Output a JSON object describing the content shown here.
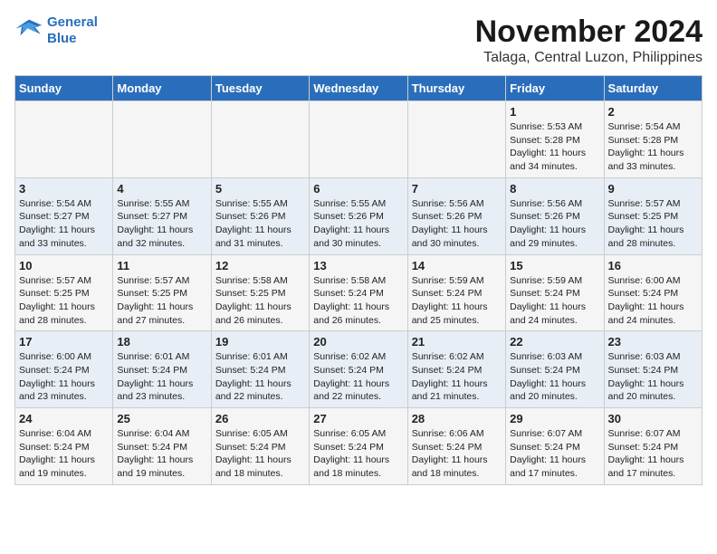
{
  "header": {
    "logo_line1": "General",
    "logo_line2": "Blue",
    "month": "November 2024",
    "location": "Talaga, Central Luzon, Philippines"
  },
  "weekdays": [
    "Sunday",
    "Monday",
    "Tuesday",
    "Wednesday",
    "Thursday",
    "Friday",
    "Saturday"
  ],
  "weeks": [
    [
      {
        "day": "",
        "info": ""
      },
      {
        "day": "",
        "info": ""
      },
      {
        "day": "",
        "info": ""
      },
      {
        "day": "",
        "info": ""
      },
      {
        "day": "",
        "info": ""
      },
      {
        "day": "1",
        "info": "Sunrise: 5:53 AM\nSunset: 5:28 PM\nDaylight: 11 hours\nand 34 minutes."
      },
      {
        "day": "2",
        "info": "Sunrise: 5:54 AM\nSunset: 5:28 PM\nDaylight: 11 hours\nand 33 minutes."
      }
    ],
    [
      {
        "day": "3",
        "info": "Sunrise: 5:54 AM\nSunset: 5:27 PM\nDaylight: 11 hours\nand 33 minutes."
      },
      {
        "day": "4",
        "info": "Sunrise: 5:55 AM\nSunset: 5:27 PM\nDaylight: 11 hours\nand 32 minutes."
      },
      {
        "day": "5",
        "info": "Sunrise: 5:55 AM\nSunset: 5:26 PM\nDaylight: 11 hours\nand 31 minutes."
      },
      {
        "day": "6",
        "info": "Sunrise: 5:55 AM\nSunset: 5:26 PM\nDaylight: 11 hours\nand 30 minutes."
      },
      {
        "day": "7",
        "info": "Sunrise: 5:56 AM\nSunset: 5:26 PM\nDaylight: 11 hours\nand 30 minutes."
      },
      {
        "day": "8",
        "info": "Sunrise: 5:56 AM\nSunset: 5:26 PM\nDaylight: 11 hours\nand 29 minutes."
      },
      {
        "day": "9",
        "info": "Sunrise: 5:57 AM\nSunset: 5:25 PM\nDaylight: 11 hours\nand 28 minutes."
      }
    ],
    [
      {
        "day": "10",
        "info": "Sunrise: 5:57 AM\nSunset: 5:25 PM\nDaylight: 11 hours\nand 28 minutes."
      },
      {
        "day": "11",
        "info": "Sunrise: 5:57 AM\nSunset: 5:25 PM\nDaylight: 11 hours\nand 27 minutes."
      },
      {
        "day": "12",
        "info": "Sunrise: 5:58 AM\nSunset: 5:25 PM\nDaylight: 11 hours\nand 26 minutes."
      },
      {
        "day": "13",
        "info": "Sunrise: 5:58 AM\nSunset: 5:24 PM\nDaylight: 11 hours\nand 26 minutes."
      },
      {
        "day": "14",
        "info": "Sunrise: 5:59 AM\nSunset: 5:24 PM\nDaylight: 11 hours\nand 25 minutes."
      },
      {
        "day": "15",
        "info": "Sunrise: 5:59 AM\nSunset: 5:24 PM\nDaylight: 11 hours\nand 24 minutes."
      },
      {
        "day": "16",
        "info": "Sunrise: 6:00 AM\nSunset: 5:24 PM\nDaylight: 11 hours\nand 24 minutes."
      }
    ],
    [
      {
        "day": "17",
        "info": "Sunrise: 6:00 AM\nSunset: 5:24 PM\nDaylight: 11 hours\nand 23 minutes."
      },
      {
        "day": "18",
        "info": "Sunrise: 6:01 AM\nSunset: 5:24 PM\nDaylight: 11 hours\nand 23 minutes."
      },
      {
        "day": "19",
        "info": "Sunrise: 6:01 AM\nSunset: 5:24 PM\nDaylight: 11 hours\nand 22 minutes."
      },
      {
        "day": "20",
        "info": "Sunrise: 6:02 AM\nSunset: 5:24 PM\nDaylight: 11 hours\nand 22 minutes."
      },
      {
        "day": "21",
        "info": "Sunrise: 6:02 AM\nSunset: 5:24 PM\nDaylight: 11 hours\nand 21 minutes."
      },
      {
        "day": "22",
        "info": "Sunrise: 6:03 AM\nSunset: 5:24 PM\nDaylight: 11 hours\nand 20 minutes."
      },
      {
        "day": "23",
        "info": "Sunrise: 6:03 AM\nSunset: 5:24 PM\nDaylight: 11 hours\nand 20 minutes."
      }
    ],
    [
      {
        "day": "24",
        "info": "Sunrise: 6:04 AM\nSunset: 5:24 PM\nDaylight: 11 hours\nand 19 minutes."
      },
      {
        "day": "25",
        "info": "Sunrise: 6:04 AM\nSunset: 5:24 PM\nDaylight: 11 hours\nand 19 minutes."
      },
      {
        "day": "26",
        "info": "Sunrise: 6:05 AM\nSunset: 5:24 PM\nDaylight: 11 hours\nand 18 minutes."
      },
      {
        "day": "27",
        "info": "Sunrise: 6:05 AM\nSunset: 5:24 PM\nDaylight: 11 hours\nand 18 minutes."
      },
      {
        "day": "28",
        "info": "Sunrise: 6:06 AM\nSunset: 5:24 PM\nDaylight: 11 hours\nand 18 minutes."
      },
      {
        "day": "29",
        "info": "Sunrise: 6:07 AM\nSunset: 5:24 PM\nDaylight: 11 hours\nand 17 minutes."
      },
      {
        "day": "30",
        "info": "Sunrise: 6:07 AM\nSunset: 5:24 PM\nDaylight: 11 hours\nand 17 minutes."
      }
    ]
  ]
}
